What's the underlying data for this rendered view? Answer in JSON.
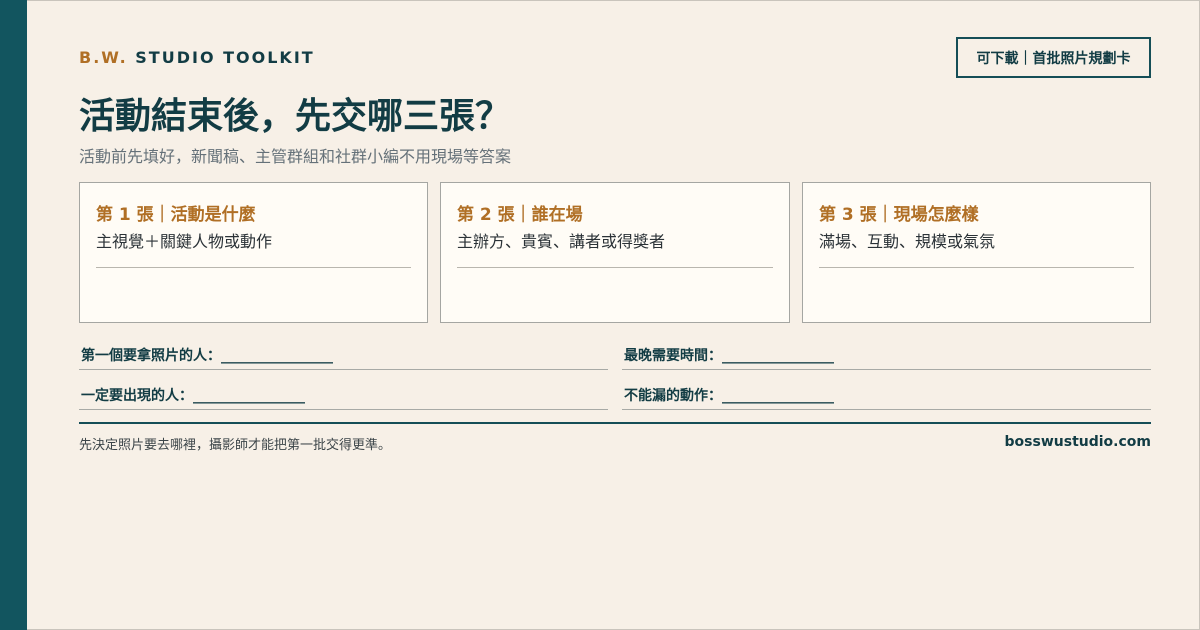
{
  "brand": {
    "accent": "B.W.",
    "name": "STUDIO TOOLKIT"
  },
  "badge": "可下載｜首批照片規劃卡",
  "title": "活動結束後，先交哪三張？",
  "subtitle": "活動前先填好，新聞稿、主管群組和社群小編不用現場等答案",
  "cards": [
    {
      "title": "第 1 張｜活動是什麼",
      "desc": "主視覺＋關鍵人物或動作"
    },
    {
      "title": "第 2 張｜誰在場",
      "desc": "主辦方、貴賓、講者或得獎者"
    },
    {
      "title": "第 3 張｜現場怎麼樣",
      "desc": "滿場、互動、規模或氣氛"
    }
  ],
  "fields": [
    "第一個要拿照片的人：________________",
    "最晚需要時間：________________",
    "一定要出現的人：________________",
    "不能漏的動作：________________"
  ],
  "footer": {
    "note": "先決定照片要去哪裡，攝影師才能把第一批交得更準。",
    "site": "bosswustudio.com"
  },
  "colors": {
    "background": "#f7f0e7",
    "teal": "#12555f",
    "accent": "#b06f25",
    "card": "#fffcf6"
  }
}
